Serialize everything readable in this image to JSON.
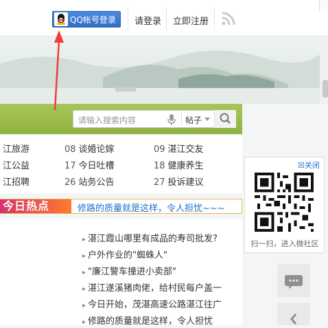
{
  "header": {
    "qq_login": "QQ帐号登录",
    "login": "请登录",
    "register": "立即注册"
  },
  "search": {
    "placeholder": "请输入搜索内容",
    "scope": "帖子"
  },
  "quick_links": [
    {
      "num": "",
      "label": "江旅游"
    },
    {
      "num": "08",
      "label": "谈婚论嫁"
    },
    {
      "num": "09",
      "label": "湛江交友"
    },
    {
      "num": "",
      "label": "江公益"
    },
    {
      "num": "17",
      "label": "今日吐槽"
    },
    {
      "num": "18",
      "label": "健康养生"
    },
    {
      "num": "",
      "label": "江招聘"
    },
    {
      "num": "26",
      "label": "站务公告"
    },
    {
      "num": "27",
      "label": "投诉建议"
    }
  ],
  "hot": {
    "tag": "今日热点",
    "headline": "修路的质量就是这样，令人担忧~~~"
  },
  "news": [
    "湛江霞山哪里有成品的寿司批发?",
    "户外作业的\"蜘蛛人\"",
    "\"廉江警车撞进小卖部\"",
    "湛江遂溪猪肉佬，给村民每户盖一",
    "今日开始，茂湛高速公路湛江往广",
    "修路的质量就是这样，令人担忧"
  ],
  "qr_panel": {
    "close": "关闭",
    "caption": "扫一扫，进入微社区"
  },
  "colors": {
    "accent_blue": "#2f6cc4",
    "green_bar": "#9ab94b",
    "hot_orange": "#ff7a2f",
    "link_blue": "#1d6fcf"
  }
}
